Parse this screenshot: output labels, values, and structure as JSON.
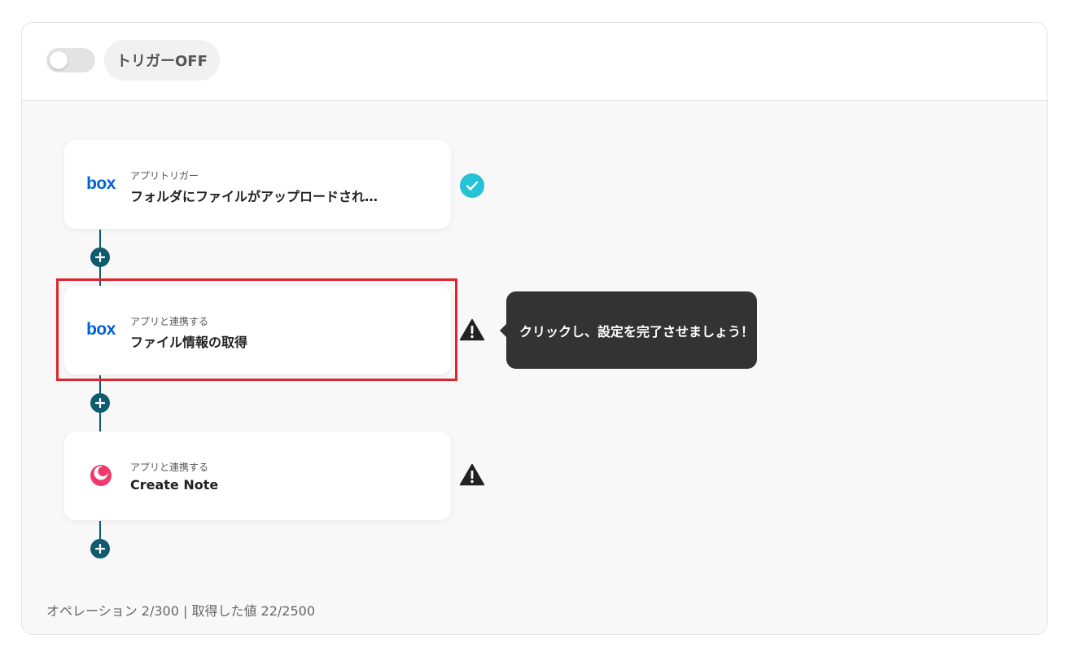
{
  "header": {
    "trigger_label": "トリガーOFF",
    "trigger_on": false
  },
  "steps": [
    {
      "sub": "アプリトリガー",
      "title": "フォルダにファイルがアップロードされ…",
      "icon": "box-logo",
      "status": "complete",
      "logo_text": "box"
    },
    {
      "sub": "アプリと連携する",
      "title": "ファイル情報の取得",
      "icon": "box-logo",
      "status": "warning",
      "logo_text": "box"
    },
    {
      "sub": "アプリと連携する",
      "title": "Create Note",
      "icon": "note-app-logo",
      "status": "warning"
    }
  ],
  "tooltip": {
    "text": "クリックし、設定を完了させましょう！"
  },
  "footer": {
    "text": "オペレーション 2/300 | 取得した値 22/2500"
  },
  "colors": {
    "connector": "#0f5a6e",
    "highlight": "#e0242b",
    "check": "#22c3d6",
    "box_blue": "#0061d5",
    "note_pink": "#f0386b"
  }
}
